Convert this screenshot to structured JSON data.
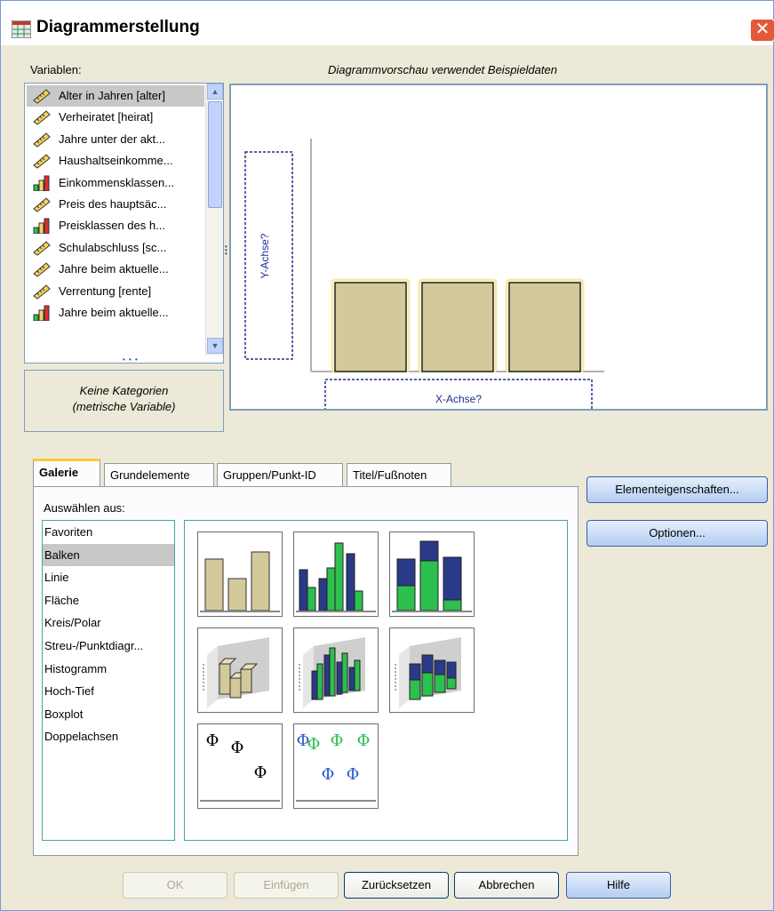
{
  "window": {
    "title": "Diagrammerstellung",
    "close_glyph": "✕",
    "accent_color": "#e3593a"
  },
  "variables": {
    "label": "Variablen:",
    "items": [
      {
        "label": "Alter in Jahren [alter]",
        "icon": "ruler-icon"
      },
      {
        "label": "Verheiratet [heirat]",
        "icon": "ruler-icon"
      },
      {
        "label": "Jahre unter der akt...",
        "icon": "ruler-icon"
      },
      {
        "label": "Haushaltseinkomme...",
        "icon": "ruler-icon"
      },
      {
        "label": "Einkommensklassen...",
        "icon": "bar-ordinal-icon"
      },
      {
        "label": "Preis des hauptsäc...",
        "icon": "ruler-icon"
      },
      {
        "label": "Preisklassen des h...",
        "icon": "bar-ordinal-icon"
      },
      {
        "label": "Schulabschluss [sc...",
        "icon": "ruler-icon"
      },
      {
        "label": "Jahre beim aktuelle...",
        "icon": "ruler-icon"
      },
      {
        "label": "Verrentung [rente]",
        "icon": "ruler-icon"
      },
      {
        "label": "Jahre beim aktuelle...",
        "icon": "bar-ordinal-icon"
      }
    ],
    "categories_line1": "Keine Kategorien",
    "categories_line2": "(metrische Variable)"
  },
  "preview": {
    "caption": "Diagrammvorschau verwendet Beispieldaten",
    "y_axis_dropzone": "Y-Achse?",
    "x_axis_dropzone": "X-Achse?",
    "bar_color": "#d4c99a"
  },
  "tabs": [
    {
      "label": "Galerie",
      "active": true
    },
    {
      "label": "Grundelemente",
      "active": false
    },
    {
      "label": "Gruppen/Punkt-ID",
      "active": false
    },
    {
      "label": "Titel/Fußnoten",
      "active": false
    }
  ],
  "gallery": {
    "choose_label": "Auswählen aus:",
    "types": [
      "Favoriten",
      "Balken",
      "Linie",
      "Fläche",
      "Kreis/Polar",
      "Streu-/Punktdiagr...",
      "Histogramm",
      "Hoch-Tief",
      "Boxplot",
      "Doppelachsen"
    ],
    "selected": "Balken",
    "series_colors": {
      "beige": "#d4c99a",
      "navy": "#2b3a87",
      "green": "#2dbf4f"
    }
  },
  "side_buttons": {
    "element_properties": "Elementeigenschaften...",
    "options": "Optionen..."
  },
  "footer_buttons": {
    "ok": "OK",
    "paste": "Einfügen",
    "reset": "Zurücksetzen",
    "cancel": "Abbrechen",
    "help": "Hilfe"
  }
}
